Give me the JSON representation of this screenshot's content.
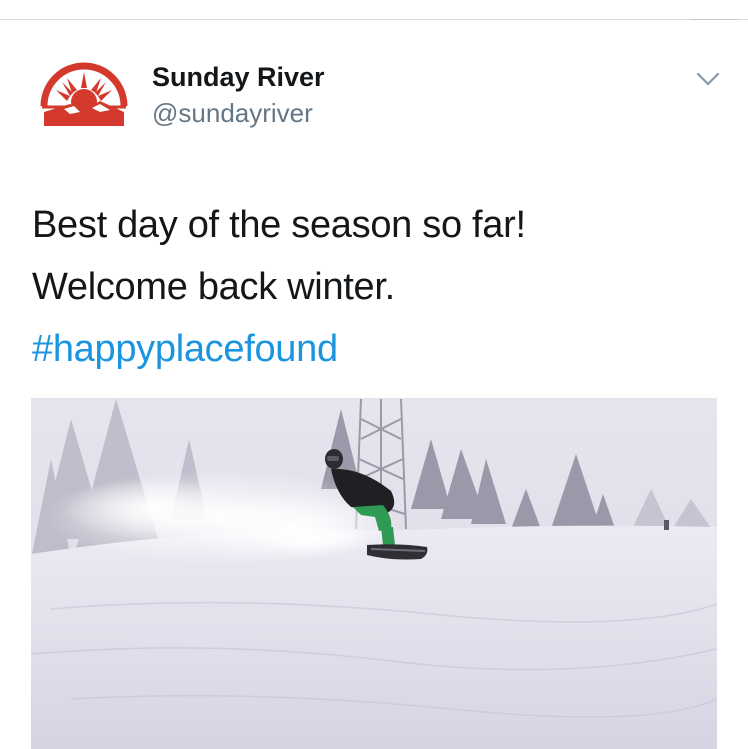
{
  "tweet": {
    "account": {
      "display_name": "Sunday River",
      "handle": "@sundayriver",
      "avatar_icon": "sunday-river-logo-icon"
    },
    "menu_icon": "chevron-down-icon",
    "text_lines": [
      "Best day of the season so far!",
      "Welcome back winter."
    ],
    "hashtag": "#happyplacefound",
    "media_icon": "snowboarder-photo"
  },
  "colors": {
    "brand_red": "#d3392c",
    "hashtag_blue": "#1b95e0",
    "text_primary": "#14171a",
    "text_secondary": "#657786"
  }
}
